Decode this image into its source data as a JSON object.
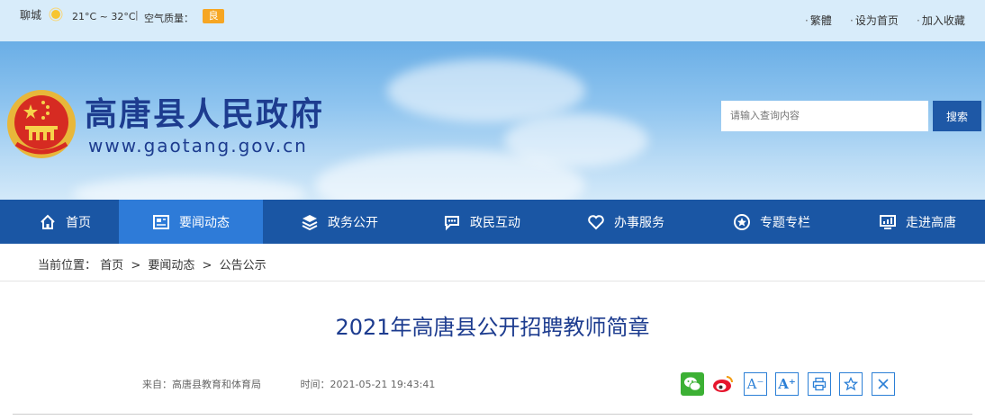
{
  "topbar": {
    "city": "聊城",
    "weather_icon": "sun-icon",
    "temperature": "21°C ~ 32°C",
    "separator": "|",
    "air_quality_label": "空气质量：",
    "air_quality_value": "良",
    "links": [
      "繁體",
      "设为首页",
      "加入收藏"
    ]
  },
  "banner": {
    "title": "高唐县人民政府",
    "url": "www.gaotang.gov.cn"
  },
  "search": {
    "placeholder": "请输入查询内容",
    "button": "搜索"
  },
  "nav": {
    "items": [
      {
        "label": "首页",
        "icon": "home-icon"
      },
      {
        "label": "要闻动态",
        "icon": "news-icon"
      },
      {
        "label": "政务公开",
        "icon": "layers-icon"
      },
      {
        "label": "政民互动",
        "icon": "chat-icon"
      },
      {
        "label": "办事服务",
        "icon": "heart-icon"
      },
      {
        "label": "专题专栏",
        "icon": "star-badge-icon"
      },
      {
        "label": "走进高唐",
        "icon": "monitor-icon"
      }
    ],
    "active_index": 1
  },
  "breadcrumb": {
    "prefix": "当前位置：",
    "items": [
      "首页",
      "要闻动态",
      "公告公示"
    ],
    "separator": ">"
  },
  "article": {
    "title": "2021年高唐县公开招聘教师简章",
    "source_label": "来自：",
    "source": "高唐县教育和体育局",
    "time_label": "时间：",
    "time": "2021-05-21 19:43:41"
  },
  "share_tools": [
    {
      "icon": "wechat-icon"
    },
    {
      "icon": "weibo-icon"
    },
    {
      "icon": "font-decrease-icon",
      "text": "A⁻"
    },
    {
      "icon": "font-increase-icon",
      "text": "A⁺"
    },
    {
      "icon": "print-icon"
    },
    {
      "icon": "favorite-star-icon"
    },
    {
      "icon": "close-icon"
    }
  ],
  "colors": {
    "nav_bg": "#1a56a4",
    "nav_active": "#2e7bd8",
    "title_blue": "#1d3c8f",
    "badge_orange": "#f6a623",
    "top_bar": "#d8ecfa"
  }
}
